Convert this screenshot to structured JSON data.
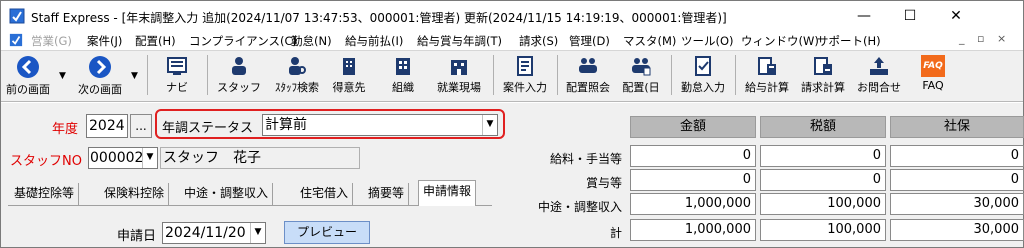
{
  "window": {
    "title": "Staff Express - [年末調整入力 追加(2024/11/07 13:47:53、000001:管理者) 更新(2024/11/15 14:19:19、000001:管理者)]",
    "minimize": "—",
    "maximize": "☐",
    "close": "✕"
  },
  "menu": {
    "items": [
      "営業(G)",
      "案件(J)",
      "配置(H)",
      "コンプライアンス(C)",
      "勤怠(N)",
      "給与前払(I)",
      "給与賞与年調(T)",
      "請求(S)",
      "管理(D)",
      "マスタ(M)",
      "ツール(O)",
      "ウィンドウ(W)",
      "サポート(H)"
    ],
    "mdi_min": "_",
    "mdi_restore": "▫",
    "mdi_close": "×"
  },
  "toolbar": {
    "labels": [
      "前の画面",
      "次の画面",
      "ナビ",
      "スタッフ",
      "ｽﾀｯﾌ検索",
      "得意先",
      "組織",
      "就業現場",
      "案件入力",
      "配置照会",
      "配置(日",
      "勤怠入力",
      "給与計算",
      "請求計算",
      "お問合せ",
      "FAQ"
    ],
    "icons": [
      "back-arrow-icon",
      "forward-arrow-icon",
      "navi-icon",
      "staff-icon",
      "staff-search-icon",
      "client-icon",
      "organization-icon",
      "worksite-icon",
      "job-entry-icon",
      "assignment-inquiry-icon",
      "assignment-daily-icon",
      "attendance-icon",
      "payroll-icon",
      "billing-icon",
      "inquiry-icon",
      "faq-icon"
    ],
    "faq_text": "FAQ",
    "accent": "#1a56c4",
    "faq_color": "#f26a1b"
  },
  "form": {
    "year_label": "年度",
    "year_value": "2024",
    "ellipsis": "...",
    "status_label": "年調ステータス",
    "status_value": "計算前",
    "staff_no_label": "スタッフNO",
    "staff_no_value": "000002",
    "staff_name": "スタッフ　花子",
    "highlight_color": "#e02020"
  },
  "tabs": [
    "基礎控除等",
    "保険料控除",
    "中途・調整収入",
    "住宅借入",
    "摘要等",
    "申請情報"
  ],
  "application": {
    "date_label": "申請日",
    "date_value": "2024/11/20",
    "preview_label": "プレビュー"
  },
  "table": {
    "headers": [
      "金額",
      "税額",
      "社保"
    ],
    "rows": [
      {
        "label": "給料・手当等",
        "values": [
          "0",
          "0",
          "0"
        ]
      },
      {
        "label": "賞与等",
        "values": [
          "0",
          "0",
          "0"
        ]
      },
      {
        "label": "中途・調整収入",
        "values": [
          "1,000,000",
          "100,000",
          "30,000"
        ]
      },
      {
        "label": "計",
        "values": [
          "1,000,000",
          "100,000",
          "30,000"
        ]
      }
    ]
  }
}
